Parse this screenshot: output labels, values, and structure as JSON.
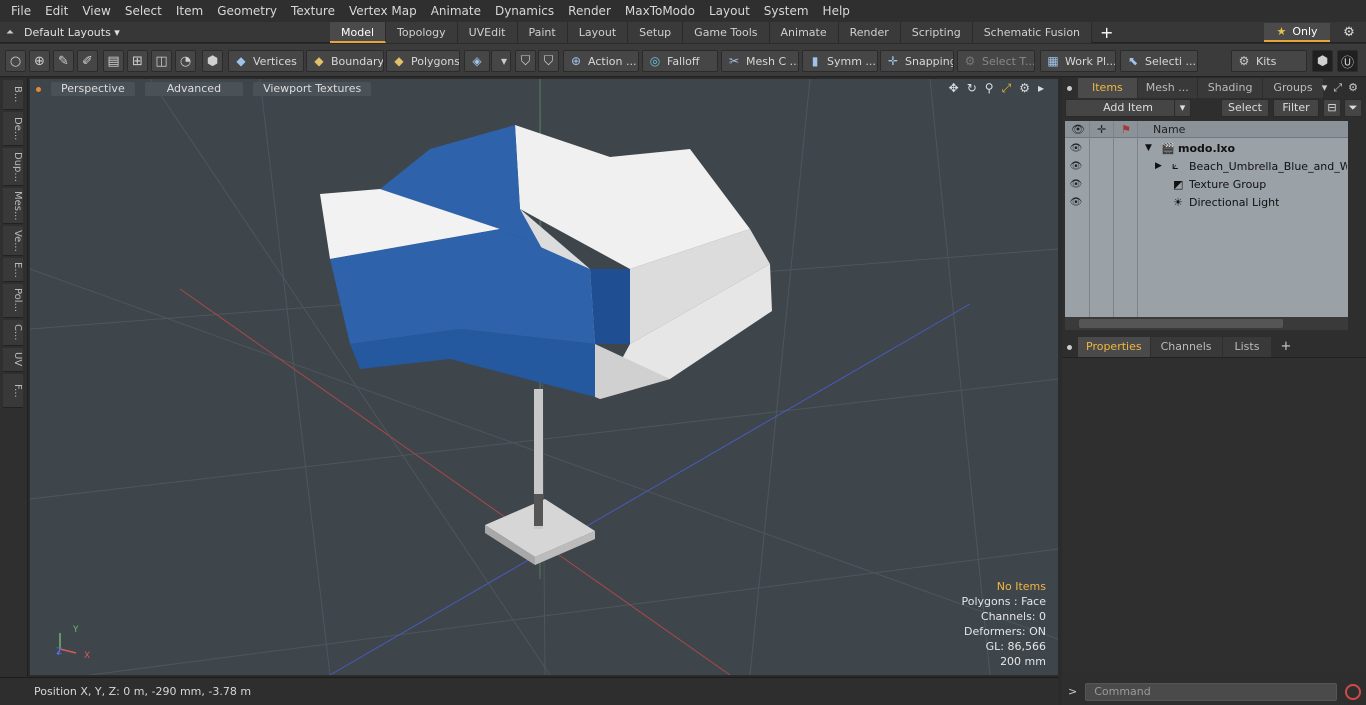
{
  "menu": [
    "File",
    "Edit",
    "View",
    "Select",
    "Item",
    "Geometry",
    "Texture",
    "Vertex Map",
    "Animate",
    "Dynamics",
    "Render",
    "MaxToModo",
    "Layout",
    "System",
    "Help"
  ],
  "layouts": {
    "current": "Default Layouts ▾"
  },
  "tabs": [
    {
      "label": "Model",
      "active": true
    },
    {
      "label": "Topology",
      "active": false
    },
    {
      "label": "UVEdit",
      "active": false
    },
    {
      "label": "Paint",
      "active": false
    },
    {
      "label": "Layout",
      "active": false
    },
    {
      "label": "Setup",
      "active": false
    },
    {
      "label": "Game Tools",
      "active": false
    },
    {
      "label": "Animate",
      "active": false
    },
    {
      "label": "Render",
      "active": false
    },
    {
      "label": "Scripting",
      "active": false
    },
    {
      "label": "Schematic Fusion",
      "active": false
    }
  ],
  "only_label": "Only",
  "toolbar": {
    "vertices": "Vertices",
    "boundary": "Boundary",
    "polygons": "Polygons",
    "action": "Action ...",
    "falloff": "Falloff",
    "meshc": "Mesh C ...",
    "symm": "Symm ...",
    "snapping": "Snapping",
    "selectt": "Select T...",
    "workpl": "Work Pl...",
    "selecti": "Selecti ...",
    "kits": "Kits"
  },
  "sidebar_tabs": [
    "B...",
    "De...",
    "Dup...",
    "Mes...",
    "Ve...",
    "E...",
    "Pol...",
    "C...",
    "UV",
    "F..."
  ],
  "viewport": {
    "mode": "Perspective",
    "advanced": "Advanced",
    "textures": "Viewport Textures",
    "info": {
      "selection": "No Items",
      "polygons": "Polygons : Face",
      "channels": "Channels: 0",
      "deformers": "Deformers: ON",
      "gl": "GL: 86,566",
      "scale": "200 mm"
    },
    "axis": {
      "x": "X",
      "y": "Y",
      "z": "Z"
    }
  },
  "status": {
    "position": "Position X, Y, Z:   0 m, -290 mm, -3.78 m"
  },
  "right_panel": {
    "tabs": [
      {
        "label": "Items",
        "active": true
      },
      {
        "label": "Mesh ...",
        "active": false
      },
      {
        "label": "Shading",
        "active": false
      },
      {
        "label": "Groups",
        "active": false
      }
    ],
    "add_item": "Add Item",
    "select": "Select",
    "filter": "Filter",
    "column_name": "Name",
    "tree": [
      {
        "label": "modo.lxo",
        "bold": true
      },
      {
        "label": "Beach_Umbrella_Blue_and_W...",
        "bold": false
      },
      {
        "label": "Texture Group",
        "bold": false
      },
      {
        "label": "Directional Light",
        "bold": false
      }
    ],
    "props_tabs": [
      {
        "label": "Properties",
        "active": true
      },
      {
        "label": "Channels",
        "active": false
      },
      {
        "label": "Lists",
        "active": false
      }
    ],
    "command_placeholder": "Command"
  }
}
